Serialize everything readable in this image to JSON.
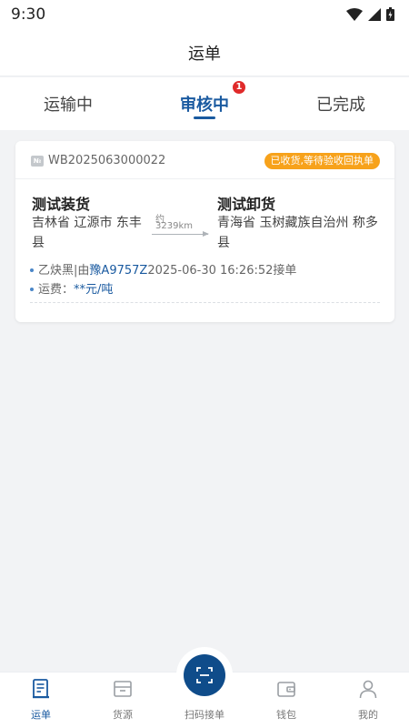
{
  "status_bar": {
    "time": "9:30"
  },
  "header": {
    "title": "运单"
  },
  "tabs": [
    {
      "label": "运输中",
      "active": false
    },
    {
      "label": "审核中",
      "active": true,
      "badge": "1"
    },
    {
      "label": "已完成",
      "active": false
    }
  ],
  "card": {
    "no_icon_text": "№",
    "waybill_no": "WB2025063000022",
    "status": "已收货,等待验收回执单",
    "from": {
      "name": "测试装货",
      "address": "吉林省 辽源市 东丰县"
    },
    "to": {
      "name": "测试卸货",
      "address": "青海省 玉树藏族自治州 称多县"
    },
    "distance": {
      "prefix": "约",
      "value": "3239km"
    },
    "driver": "乙炔黑",
    "separator": "|",
    "by_prefix": "由",
    "plate": "豫A9757Z",
    "accepted_time": "2025-06-30 16:26:52",
    "accepted_suffix": "接单",
    "fee_label": "运费：",
    "fee_value": "**元/吨"
  },
  "bottom_nav": [
    {
      "label": "运单",
      "active": true
    },
    {
      "label": "货源",
      "active": false
    },
    {
      "label": "扫码接单",
      "active": false
    },
    {
      "label": "钱包",
      "active": false
    },
    {
      "label": "我的",
      "active": false
    }
  ],
  "colors": {
    "brand": "#1a5aa0",
    "status_orange": "#f7a21b",
    "badge_red": "#e02a2a",
    "scan_button": "#0f4c8a"
  }
}
